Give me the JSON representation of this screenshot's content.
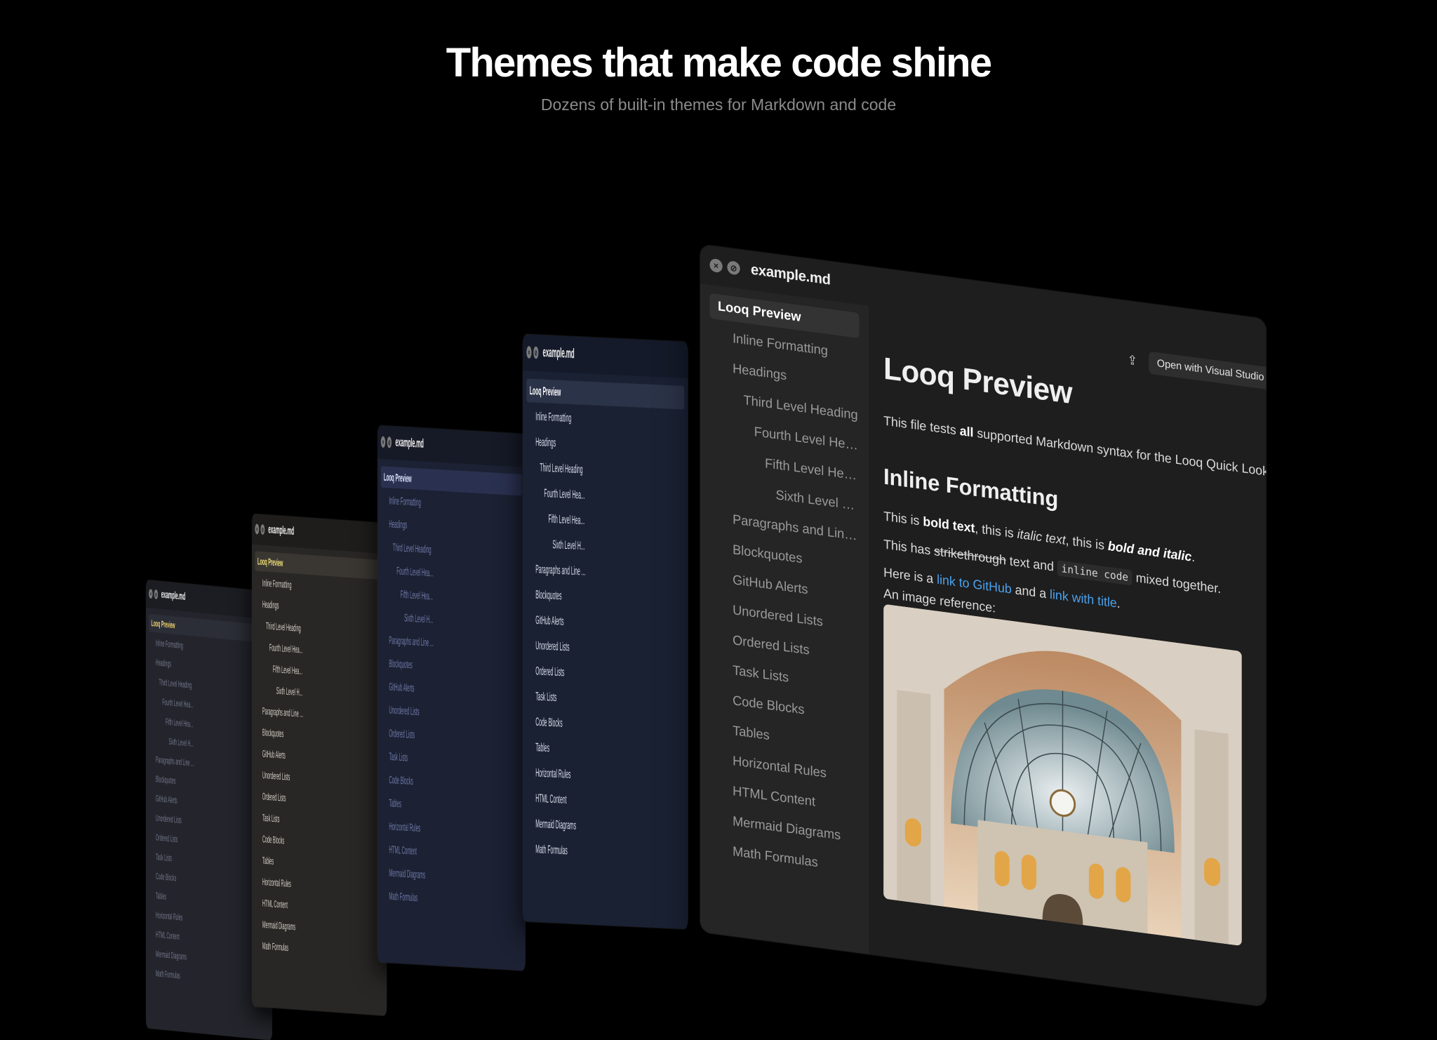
{
  "hero": {
    "title": "Themes that make code shine",
    "subtitle": "Dozens of built-in themes for Markdown and code"
  },
  "window": {
    "title": "example.md",
    "close_icon": "close-icon",
    "minimize_icon": "minimize-icon",
    "share_icon": "share-icon",
    "open_button": "Open with Visual Studio Code"
  },
  "sidebar": {
    "items": [
      {
        "label": "Looq Preview",
        "level": 0,
        "selected": true
      },
      {
        "label": "Inline Formatting",
        "level": 1
      },
      {
        "label": "Headings",
        "level": 1
      },
      {
        "label": "Third Level Heading",
        "level": 3
      },
      {
        "label": "Fourth Level Hea...",
        "level": 4
      },
      {
        "label": "Fifth Level Hea...",
        "level": 5
      },
      {
        "label": "Sixth Level H...",
        "level": 6
      },
      {
        "label": "Paragraphs and Line ...",
        "level": 1
      },
      {
        "label": "Blockquotes",
        "level": 1
      },
      {
        "label": "GitHub Alerts",
        "level": 1
      },
      {
        "label": "Unordered Lists",
        "level": 1
      },
      {
        "label": "Ordered Lists",
        "level": 1
      },
      {
        "label": "Task Lists",
        "level": 1
      },
      {
        "label": "Code Blocks",
        "level": 1
      },
      {
        "label": "Tables",
        "level": 1
      },
      {
        "label": "Horizontal Rules",
        "level": 1
      },
      {
        "label": "HTML Content",
        "level": 1
      },
      {
        "label": "Mermaid Diagrams",
        "level": 1
      },
      {
        "label": "Math Formulas",
        "level": 1
      }
    ]
  },
  "document": {
    "h1": "Looq Preview",
    "intro_before": "This file tests ",
    "intro_bold": "all",
    "intro_after": " supported Markdown syntax for the Looq Quick Look extension.",
    "h2": "Inline Formatting",
    "line1_a": "This is ",
    "line1_bold": "bold text",
    "line1_b": ", this is ",
    "line1_italic": "italic text",
    "line1_c": ", this is ",
    "line1_bolditalic": "bold and italic",
    "line1_d": ".",
    "line2_a": "This has ",
    "line2_strike": "strikethrough",
    "line2_b": " text and ",
    "line2_code": "inline code",
    "line2_c": " mixed together.",
    "line3_a": "Here is a ",
    "line3_link1": "link to GitHub",
    "line3_b": " and a ",
    "line3_link2": "link with title",
    "line3_c": ".",
    "image_caption": "An image reference:",
    "image_icon": "train-station-photo"
  },
  "themes": [
    {
      "name": "theme-1",
      "window_bg": "#1c1d22",
      "sidebar_bg": "#24252c",
      "text": "#6f7488",
      "selected_text": "#f3d36b",
      "selected_bg": "#2c2e37"
    },
    {
      "name": "theme-2",
      "window_bg": "#1e1d1b",
      "sidebar_bg": "#292725",
      "text": "#d2cec6",
      "selected_text": "#f4e27a",
      "selected_bg": "#3a3732"
    },
    {
      "name": "theme-3",
      "window_bg": "#161a26",
      "sidebar_bg": "#1c2133",
      "text": "#6e7aa8",
      "selected_text": "#dfe6ff",
      "selected_bg": "#2a3150"
    },
    {
      "name": "theme-4",
      "window_bg": "#141a29",
      "sidebar_bg": "#1a2133",
      "text": "#d9deea",
      "selected_text": "#ffffff",
      "selected_bg": "#2b3348"
    },
    {
      "name": "theme-5",
      "window_bg": "#1e1e1e",
      "sidebar_bg": "#252525",
      "text": "#9a9a9a",
      "selected_text": "#ffffff",
      "selected_bg": "#333333"
    }
  ]
}
